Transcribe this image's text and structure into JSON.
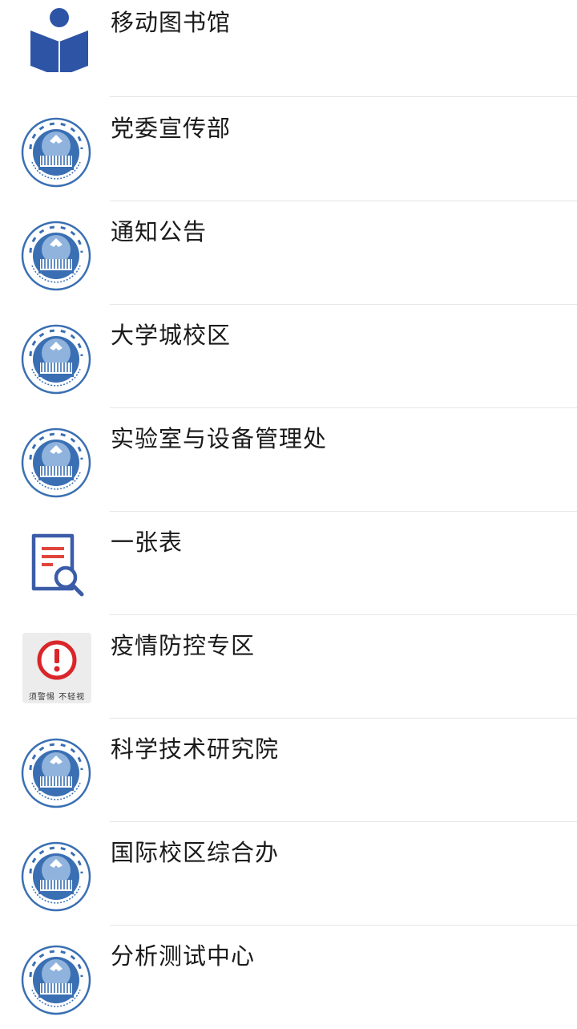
{
  "accounts": [
    {
      "name": "移动图书馆",
      "icon": "library-book-icon"
    },
    {
      "name": "党委宣传部",
      "icon": "university-seal-icon"
    },
    {
      "name": "通知公告",
      "icon": "university-seal-icon"
    },
    {
      "name": "大学城校区",
      "icon": "university-seal-icon"
    },
    {
      "name": "实验室与设备管理处",
      "icon": "university-seal-icon"
    },
    {
      "name": "一张表",
      "icon": "form-search-icon"
    },
    {
      "name": "疫情防控专区",
      "icon": "alert-warning-icon",
      "caption": "须警惕 不轻视"
    },
    {
      "name": "科学技术研究院",
      "icon": "university-seal-icon"
    },
    {
      "name": "国际校区综合办",
      "icon": "university-seal-icon"
    },
    {
      "name": "分析测试中心",
      "icon": "university-seal-icon"
    }
  ],
  "colors": {
    "divider": "#e6e6e6",
    "text": "#1a1a1a",
    "library_blue": "#2e54a6",
    "seal_blue": "#3a6fb3",
    "form_blue": "#3b5ca8",
    "form_red": "#e0453d",
    "alert_red": "#d9262a"
  }
}
